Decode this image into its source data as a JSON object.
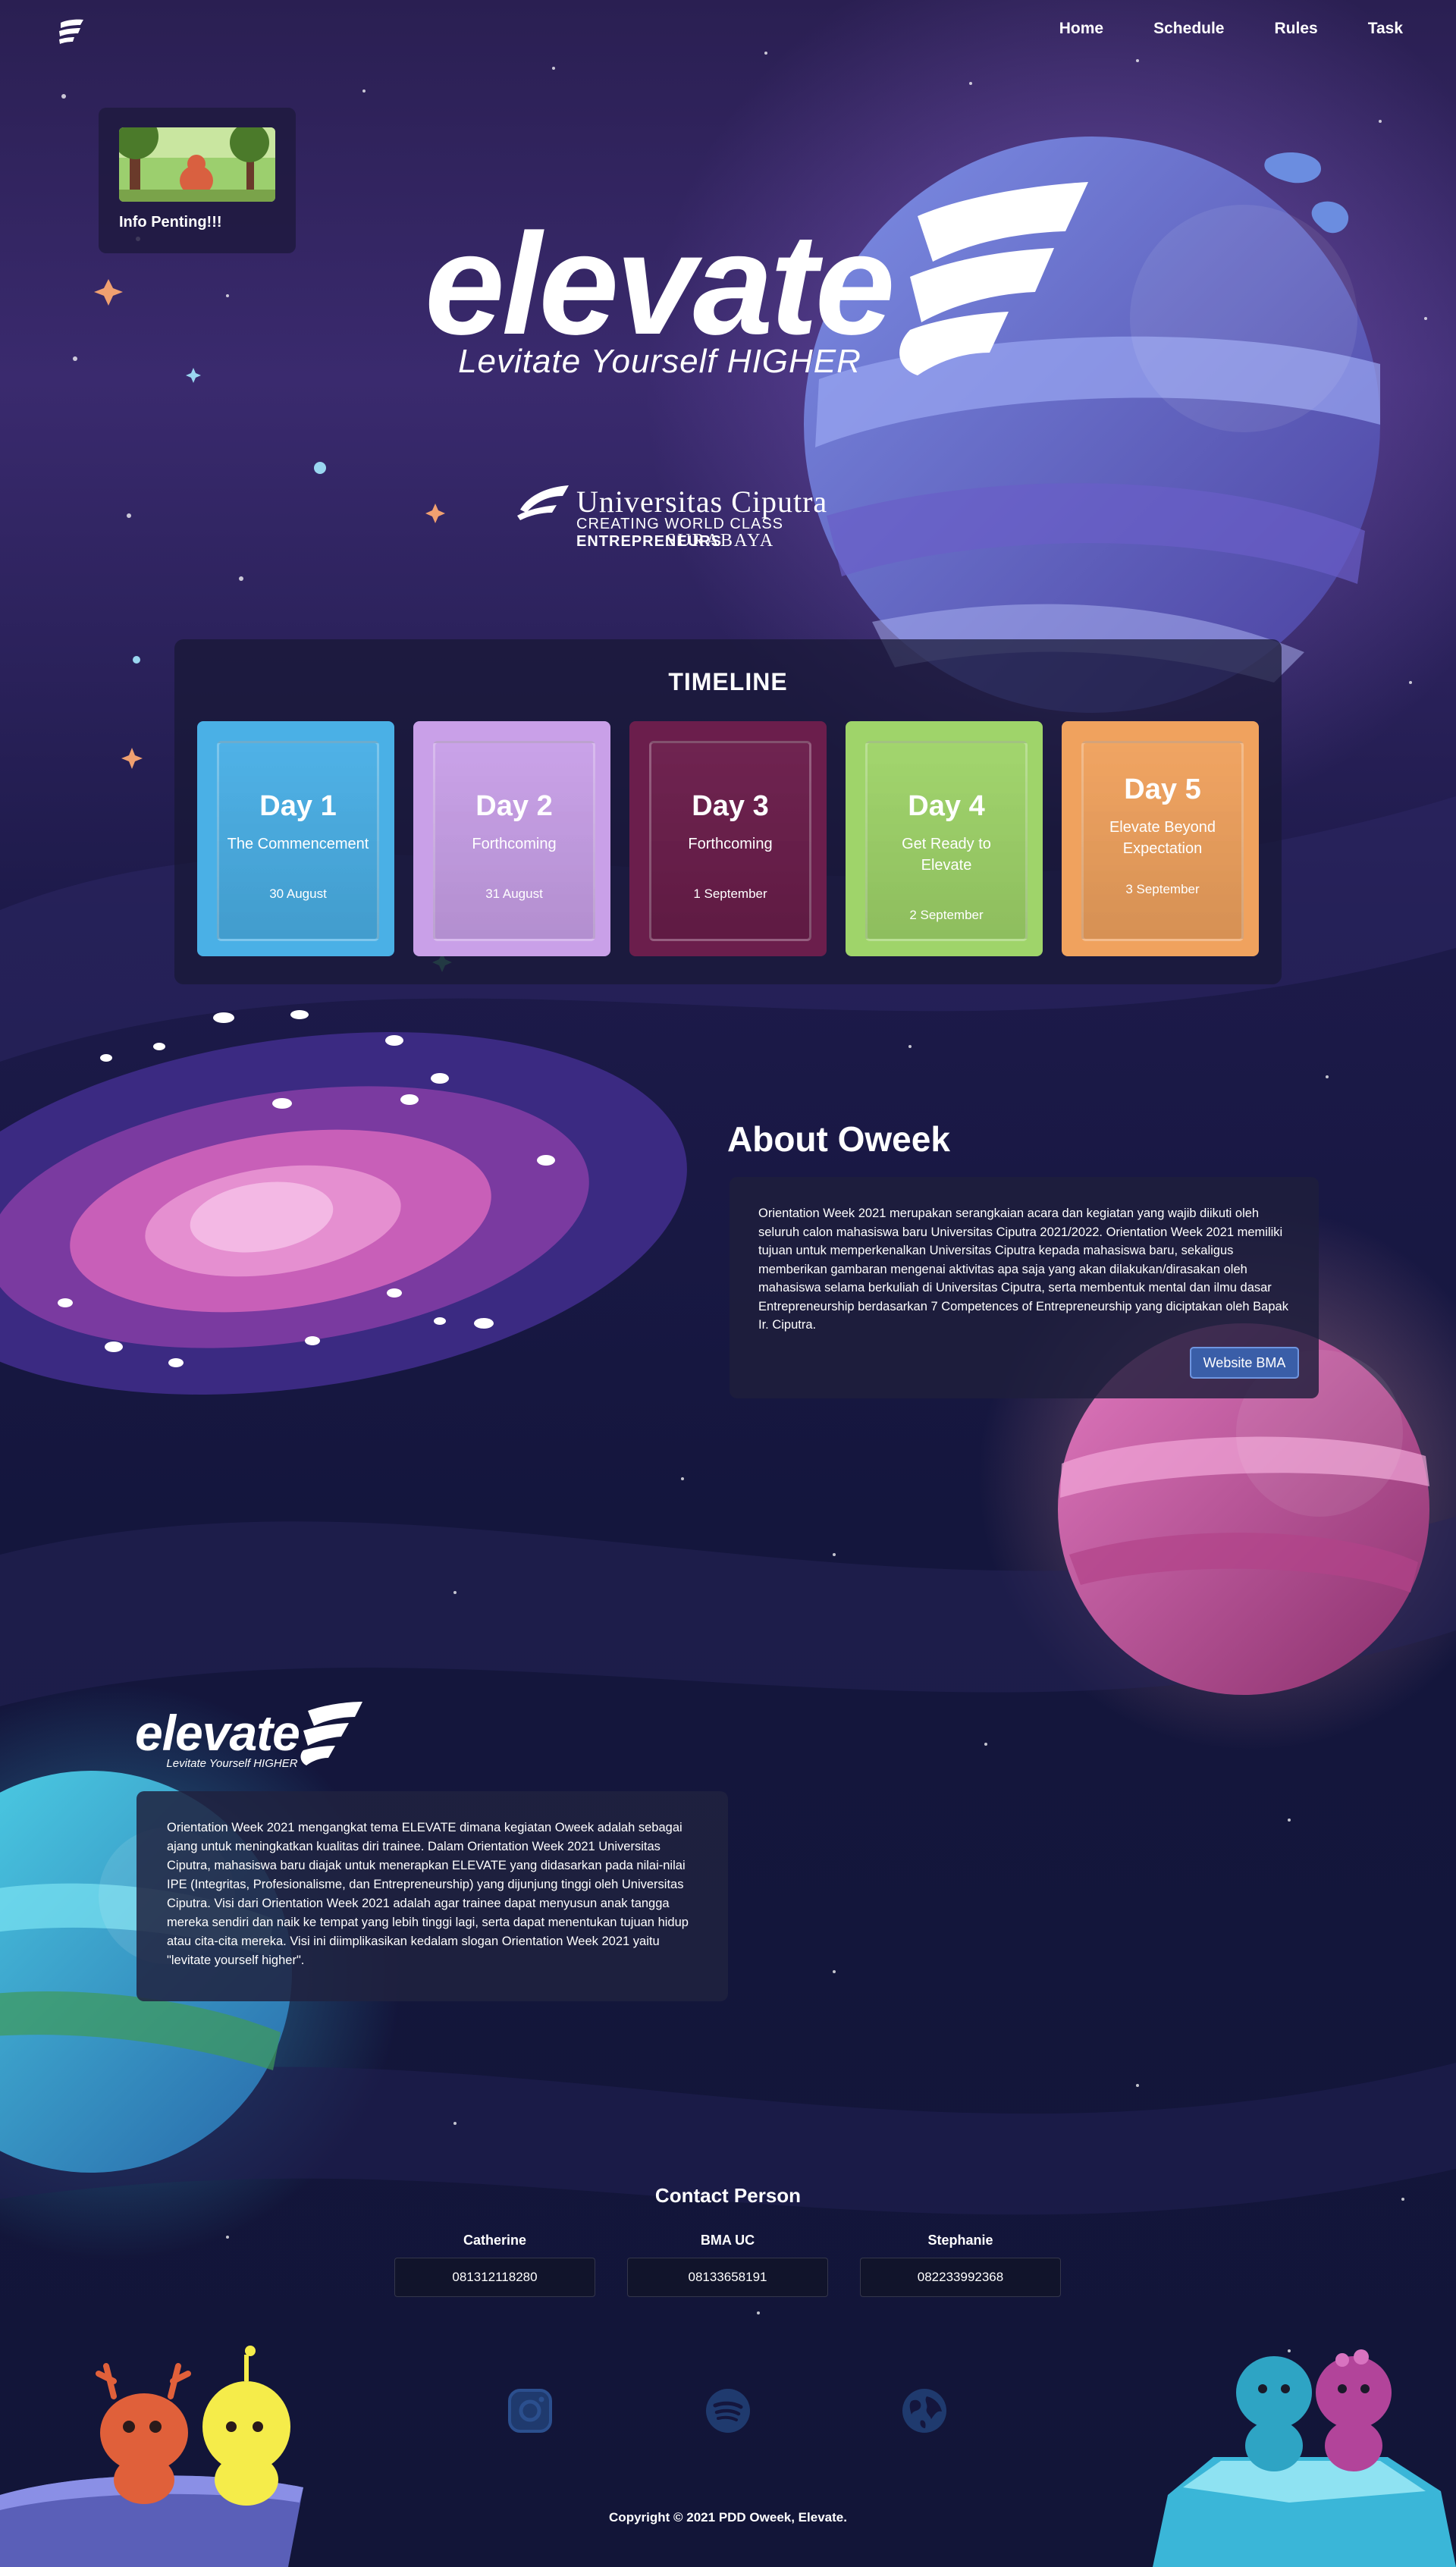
{
  "nav": {
    "logo_icon": "elevate-logo-icon",
    "links": [
      "Home",
      "Schedule",
      "Rules",
      "Task"
    ]
  },
  "info_card": {
    "label": "Info Penting!!!"
  },
  "hero": {
    "title": "elevate",
    "tagline": "Levitate Yourself HIGHER"
  },
  "university": {
    "name": "Universitas Ciputra",
    "tagline_prefix": "CREATING WORLD CLASS ",
    "tagline_emph": "ENTREPRENEURS",
    "city": "SURABAYA"
  },
  "timeline": {
    "title": "TIMELINE",
    "days": [
      {
        "num": "Day 1",
        "title": "The Commencement",
        "date": "30 August",
        "color": "#4ab0e6"
      },
      {
        "num": "Day 2",
        "title": "Forthcoming",
        "date": "31 August",
        "color": "#c9a0e8"
      },
      {
        "num": "Day 3",
        "title": "Forthcoming",
        "date": "1 September",
        "color": "#6b1e4c"
      },
      {
        "num": "Day 4",
        "title": "Get Ready to Elevate",
        "date": "2 September",
        "color": "#9fd46a"
      },
      {
        "num": "Day 5",
        "title": "Elevate Beyond Expectation",
        "date": "3 September",
        "color": "#f0a25e"
      }
    ]
  },
  "about": {
    "heading": "About Oweek",
    "text": "Orientation Week 2021 merupakan serangkaian acara dan kegiatan yang wajib diikuti oleh seluruh calon mahasiswa baru Universitas Ciputra 2021/2022. Orientation Week 2021 memiliki tujuan untuk memperkenalkan Universitas Ciputra kepada mahasiswa baru, sekaligus memberikan gambaran mengenai aktivitas apa saja yang akan dilakukan/dirasakan oleh mahasiswa selama berkuliah di Universitas Ciputra, serta membentuk mental dan ilmu dasar Entrepreneurship berdasarkan 7 Competences of Entrepreneurship yang diciptakan oleh Bapak Ir. Ciputra.",
    "button": "Website BMA"
  },
  "elevate_section": {
    "logo_text": "elevate",
    "tagline": "Levitate Yourself HIGHER",
    "text": "Orientation Week 2021 mengangkat tema ELEVATE dimana kegiatan Oweek adalah sebagai ajang untuk meningkatkan kualitas diri trainee. Dalam Orientation Week 2021 Universitas Ciputra, mahasiswa baru diajak untuk menerapkan ELEVATE yang didasarkan pada nilai-nilai IPE (Integritas, Profesionalisme, dan Entrepreneurship) yang dijunjung tinggi oleh Universitas Ciputra. Visi dari Orientation Week 2021 adalah agar trainee dapat menyusun anak tangga mereka sendiri dan naik ke tempat yang lebih tinggi lagi, serta dapat menentukan tujuan hidup atau cita-cita mereka. Visi ini diimplikasikan kedalam slogan Orientation Week 2021 yaitu \"levitate yourself higher\"."
  },
  "contact": {
    "title": "Contact Person",
    "people": [
      {
        "name": "Catherine",
        "phone": "081312118280"
      },
      {
        "name": "BMA UC",
        "phone": "08133658191"
      },
      {
        "name": "Stephanie",
        "phone": "082233992368"
      }
    ]
  },
  "social": [
    "instagram-icon",
    "spotify-icon",
    "globe-icon"
  ],
  "footer": {
    "copyright": "Copyright © 2021 PDD Oweek, Elevate."
  }
}
